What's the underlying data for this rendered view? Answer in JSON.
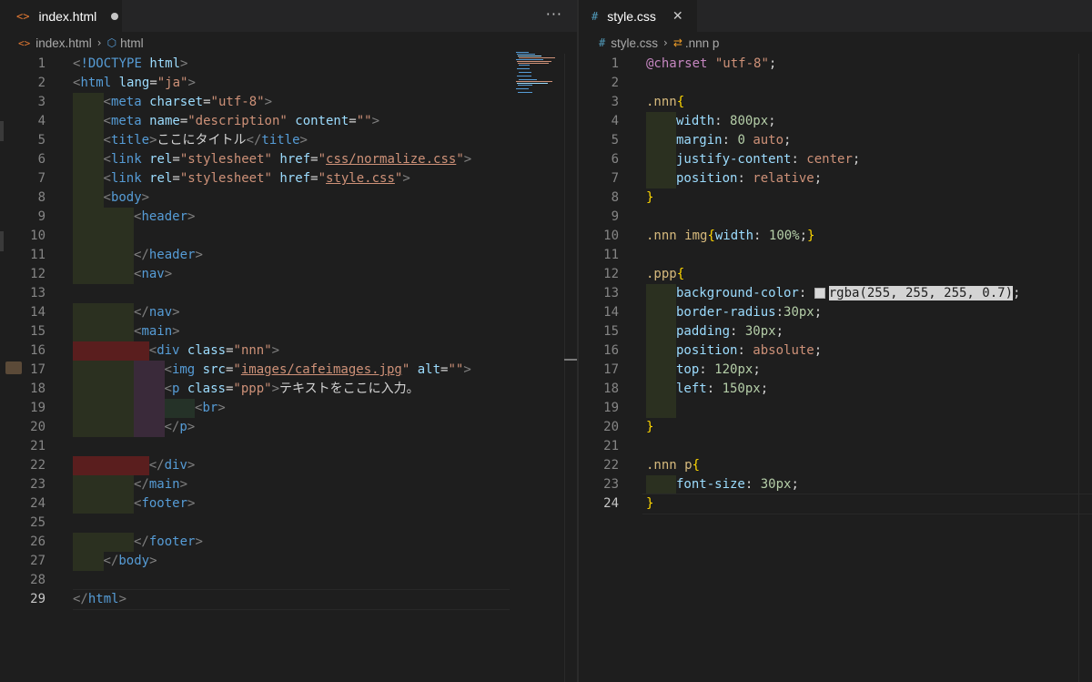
{
  "left": {
    "tab": {
      "icon": "<>",
      "label": "index.html"
    },
    "breadcrumb": {
      "file": "index.html",
      "symbol": "html"
    },
    "lines": [
      {
        "n": "1",
        "t": [
          [
            "punc",
            "<"
          ],
          [
            "tag",
            "!DOCTYPE"
          ],
          [
            "txt",
            " "
          ],
          [
            "attr",
            "html"
          ],
          [
            "punc",
            ">"
          ]
        ]
      },
      {
        "n": "2",
        "t": [
          [
            "punc",
            "<"
          ],
          [
            "tag",
            "html"
          ],
          [
            "txt",
            " "
          ],
          [
            "attr",
            "lang"
          ],
          [
            "txt",
            "="
          ],
          [
            "str",
            "\"ja\""
          ],
          [
            "punc",
            ">"
          ]
        ]
      },
      {
        "n": "3",
        "t": [
          [
            "punc",
            "<"
          ],
          [
            "tag",
            "meta"
          ],
          [
            "txt",
            " "
          ],
          [
            "attr",
            "charset"
          ],
          [
            "txt",
            "="
          ],
          [
            "str",
            "\"utf-8\""
          ],
          [
            "punc",
            ">"
          ]
        ]
      },
      {
        "n": "4",
        "t": [
          [
            "punc",
            "<"
          ],
          [
            "tag",
            "meta"
          ],
          [
            "txt",
            " "
          ],
          [
            "attr",
            "name"
          ],
          [
            "txt",
            "="
          ],
          [
            "str",
            "\"description\""
          ],
          [
            "txt",
            " "
          ],
          [
            "attr",
            "content"
          ],
          [
            "txt",
            "="
          ],
          [
            "str",
            "\"\""
          ],
          [
            "punc",
            ">"
          ]
        ]
      },
      {
        "n": "5",
        "t": [
          [
            "punc",
            "<"
          ],
          [
            "tag",
            "title"
          ],
          [
            "punc",
            ">"
          ],
          [
            "txt",
            "ここにタイトル"
          ],
          [
            "punc",
            "</"
          ],
          [
            "tag",
            "title"
          ],
          [
            "punc",
            ">"
          ]
        ]
      },
      {
        "n": "6",
        "t": [
          [
            "punc",
            "<"
          ],
          [
            "tag",
            "link"
          ],
          [
            "txt",
            " "
          ],
          [
            "attr",
            "rel"
          ],
          [
            "txt",
            "="
          ],
          [
            "str",
            "\"stylesheet\""
          ],
          [
            "txt",
            " "
          ],
          [
            "attr",
            "href"
          ],
          [
            "txt",
            "="
          ],
          [
            "str",
            "\""
          ],
          [
            "strl",
            "css/normalize.css"
          ],
          [
            "str",
            "\""
          ],
          [
            "punc",
            ">"
          ]
        ]
      },
      {
        "n": "7",
        "t": [
          [
            "punc",
            "<"
          ],
          [
            "tag",
            "link"
          ],
          [
            "txt",
            " "
          ],
          [
            "attr",
            "rel"
          ],
          [
            "txt",
            "="
          ],
          [
            "str",
            "\"stylesheet\""
          ],
          [
            "txt",
            " "
          ],
          [
            "attr",
            "href"
          ],
          [
            "txt",
            "="
          ],
          [
            "str",
            "\""
          ],
          [
            "strl",
            "style.css"
          ],
          [
            "str",
            "\""
          ],
          [
            "punc",
            ">"
          ]
        ]
      },
      {
        "n": "8",
        "t": [
          [
            "punc",
            "<"
          ],
          [
            "tag",
            "body"
          ],
          [
            "punc",
            ">"
          ]
        ]
      },
      {
        "n": "9",
        "t": [
          [
            "punc",
            "<"
          ],
          [
            "tag",
            "header"
          ],
          [
            "punc",
            ">"
          ]
        ]
      },
      {
        "n": "10",
        "t": []
      },
      {
        "n": "11",
        "t": [
          [
            "punc",
            "</"
          ],
          [
            "tag",
            "header"
          ],
          [
            "punc",
            ">"
          ]
        ]
      },
      {
        "n": "12",
        "t": [
          [
            "punc",
            "<"
          ],
          [
            "tag",
            "nav"
          ],
          [
            "punc",
            ">"
          ]
        ]
      },
      {
        "n": "13",
        "t": []
      },
      {
        "n": "14",
        "t": [
          [
            "punc",
            "</"
          ],
          [
            "tag",
            "nav"
          ],
          [
            "punc",
            ">"
          ]
        ]
      },
      {
        "n": "15",
        "t": [
          [
            "punc",
            "<"
          ],
          [
            "tag",
            "main"
          ],
          [
            "punc",
            ">"
          ]
        ]
      },
      {
        "n": "16",
        "t": [
          [
            "punc",
            "<"
          ],
          [
            "tag",
            "div"
          ],
          [
            "txt",
            " "
          ],
          [
            "attr",
            "class"
          ],
          [
            "txt",
            "="
          ],
          [
            "str",
            "\"nnn\""
          ],
          [
            "punc",
            ">"
          ]
        ]
      },
      {
        "n": "17",
        "t": [
          [
            "punc",
            "<"
          ],
          [
            "tag",
            "img"
          ],
          [
            "txt",
            " "
          ],
          [
            "attr",
            "src"
          ],
          [
            "txt",
            "="
          ],
          [
            "str",
            "\""
          ],
          [
            "strl",
            "images/cafeimages.jpg"
          ],
          [
            "str",
            "\""
          ],
          [
            "txt",
            " "
          ],
          [
            "attr",
            "alt"
          ],
          [
            "txt",
            "="
          ],
          [
            "str",
            "\"\""
          ],
          [
            "punc",
            ">"
          ]
        ]
      },
      {
        "n": "18",
        "t": [
          [
            "punc",
            "<"
          ],
          [
            "tag",
            "p"
          ],
          [
            "txt",
            " "
          ],
          [
            "attr",
            "class"
          ],
          [
            "txt",
            "="
          ],
          [
            "str",
            "\"ppp\""
          ],
          [
            "punc",
            ">"
          ],
          [
            "txt",
            "テキストをここに入力。"
          ]
        ]
      },
      {
        "n": "19",
        "t": [
          [
            "punc",
            "<"
          ],
          [
            "tag",
            "br"
          ],
          [
            "punc",
            ">"
          ]
        ]
      },
      {
        "n": "20",
        "t": [
          [
            "punc",
            "</"
          ],
          [
            "tag",
            "p"
          ],
          [
            "punc",
            ">"
          ]
        ]
      },
      {
        "n": "21",
        "t": []
      },
      {
        "n": "22",
        "t": [
          [
            "punc",
            "</"
          ],
          [
            "tag",
            "div"
          ],
          [
            "punc",
            ">"
          ]
        ]
      },
      {
        "n": "23",
        "t": [
          [
            "punc",
            "</"
          ],
          [
            "tag",
            "main"
          ],
          [
            "punc",
            ">"
          ]
        ]
      },
      {
        "n": "24",
        "t": [
          [
            "punc",
            "<"
          ],
          [
            "tag",
            "footer"
          ],
          [
            "punc",
            ">"
          ]
        ]
      },
      {
        "n": "25",
        "t": []
      },
      {
        "n": "26",
        "t": [
          [
            "punc",
            "</"
          ],
          [
            "tag",
            "footer"
          ],
          [
            "punc",
            ">"
          ]
        ]
      },
      {
        "n": "27",
        "t": [
          [
            "punc",
            "</"
          ],
          [
            "tag",
            "body"
          ],
          [
            "punc",
            ">"
          ]
        ]
      },
      {
        "n": "28",
        "t": []
      },
      {
        "n": "29",
        "t": [
          [
            "punc",
            "</"
          ],
          [
            "tag",
            "html"
          ],
          [
            "punc",
            ">"
          ]
        ]
      }
    ]
  },
  "right": {
    "tab": {
      "icon": "#",
      "label": "style.css"
    },
    "breadcrumb": {
      "file": "style.css",
      "symbol": ".nnn p"
    },
    "lines": [
      {
        "n": "1",
        "t": [
          [
            "at",
            "@charset"
          ],
          [
            "txt",
            " "
          ],
          [
            "val",
            "\"utf-8\""
          ],
          [
            "txt",
            ";"
          ]
        ]
      },
      {
        "n": "2",
        "t": []
      },
      {
        "n": "3",
        "t": [
          [
            "sel",
            ".nnn"
          ],
          [
            "brace",
            "{"
          ]
        ]
      },
      {
        "n": "4",
        "t": [
          [
            "prop",
            "width"
          ],
          [
            "txt",
            ": "
          ],
          [
            "num",
            "800px"
          ],
          [
            "txt",
            ";"
          ]
        ]
      },
      {
        "n": "5",
        "t": [
          [
            "prop",
            "margin"
          ],
          [
            "txt",
            ": "
          ],
          [
            "num",
            "0"
          ],
          [
            "txt",
            " "
          ],
          [
            "val",
            "auto"
          ],
          [
            "txt",
            ";"
          ]
        ]
      },
      {
        "n": "6",
        "t": [
          [
            "prop",
            "justify-content"
          ],
          [
            "txt",
            ": "
          ],
          [
            "val",
            "center"
          ],
          [
            "txt",
            ";"
          ]
        ]
      },
      {
        "n": "7",
        "t": [
          [
            "prop",
            "position"
          ],
          [
            "txt",
            ": "
          ],
          [
            "val",
            "relative"
          ],
          [
            "txt",
            ";"
          ]
        ]
      },
      {
        "n": "8",
        "t": [
          [
            "brace",
            "}"
          ]
        ]
      },
      {
        "n": "9",
        "t": []
      },
      {
        "n": "10",
        "t": [
          [
            "sel",
            ".nnn img"
          ],
          [
            "brace",
            "{"
          ],
          [
            "prop",
            "width"
          ],
          [
            "txt",
            ": "
          ],
          [
            "num",
            "100%"
          ],
          [
            "txt",
            ";"
          ],
          [
            "brace",
            "}"
          ]
        ]
      },
      {
        "n": "11",
        "t": []
      },
      {
        "n": "12",
        "t": [
          [
            "sel",
            ".ppp"
          ],
          [
            "brace",
            "{"
          ]
        ]
      },
      {
        "n": "13",
        "t": [
          [
            "prop",
            "background-color"
          ],
          [
            "txt",
            ": "
          ],
          [
            "colbox",
            ""
          ],
          [
            "rgba",
            "rgba(255, 255, 255, 0.7)"
          ],
          [
            "txt",
            ";"
          ]
        ]
      },
      {
        "n": "14",
        "t": [
          [
            "prop",
            "border-radius"
          ],
          [
            "txt",
            ":"
          ],
          [
            "num",
            "30px"
          ],
          [
            "txt",
            ";"
          ]
        ]
      },
      {
        "n": "15",
        "t": [
          [
            "prop",
            "padding"
          ],
          [
            "txt",
            ": "
          ],
          [
            "num",
            "30px"
          ],
          [
            "txt",
            ";"
          ]
        ]
      },
      {
        "n": "16",
        "t": [
          [
            "prop",
            "position"
          ],
          [
            "txt",
            ": "
          ],
          [
            "val",
            "absolute"
          ],
          [
            "txt",
            ";"
          ]
        ]
      },
      {
        "n": "17",
        "t": [
          [
            "prop",
            "top"
          ],
          [
            "txt",
            ": "
          ],
          [
            "num",
            "120px"
          ],
          [
            "txt",
            ";"
          ]
        ]
      },
      {
        "n": "18",
        "t": [
          [
            "prop",
            "left"
          ],
          [
            "txt",
            ": "
          ],
          [
            "num",
            "150px"
          ],
          [
            "txt",
            ";"
          ]
        ]
      },
      {
        "n": "19",
        "t": []
      },
      {
        "n": "20",
        "t": [
          [
            "brace",
            "}"
          ]
        ]
      },
      {
        "n": "21",
        "t": []
      },
      {
        "n": "22",
        "t": [
          [
            "sel",
            ".nnn p"
          ],
          [
            "brace",
            "{"
          ]
        ]
      },
      {
        "n": "23",
        "t": [
          [
            "prop",
            "font-size"
          ],
          [
            "txt",
            ": "
          ],
          [
            "num",
            "30px"
          ],
          [
            "txt",
            ";"
          ]
        ]
      },
      {
        "n": "24",
        "t": [
          [
            "brace",
            "}"
          ]
        ]
      }
    ]
  },
  "more_label": "···"
}
